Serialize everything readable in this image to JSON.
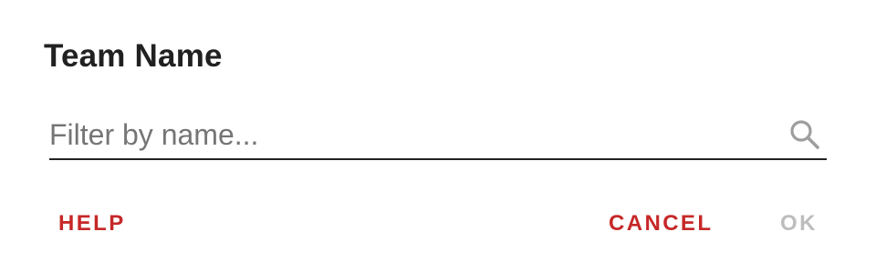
{
  "dialog": {
    "title": "Team Name",
    "search": {
      "value": "",
      "placeholder": "Filter by name..."
    },
    "buttons": {
      "help": "HELP",
      "cancel": "CANCEL",
      "ok": "OK"
    },
    "icons": {
      "search": "search-icon"
    },
    "colors": {
      "accent": "#c62828",
      "disabled": "#bdbdbd",
      "text": "#212121",
      "placeholder": "#757575"
    },
    "state": {
      "ok_disabled": true
    }
  }
}
